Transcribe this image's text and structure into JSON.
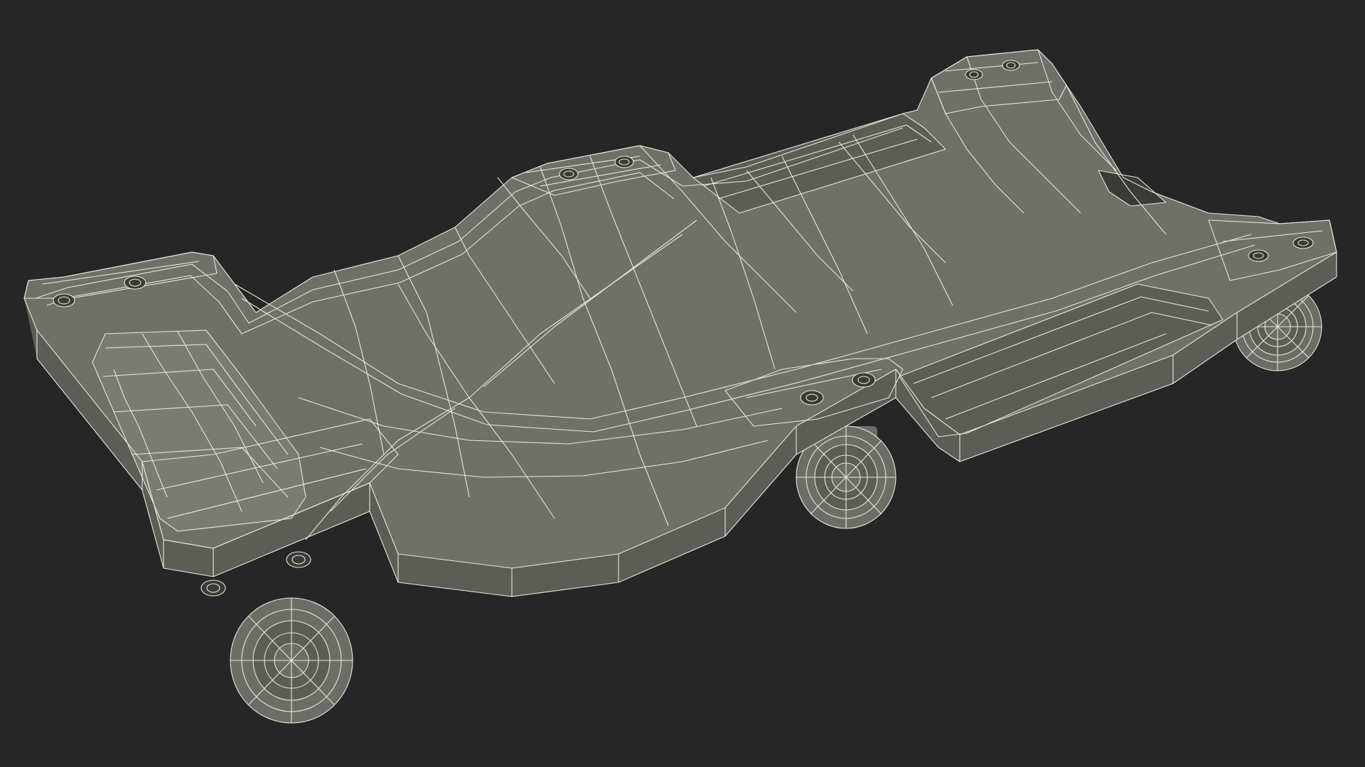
{
  "scene": {
    "subject": "creeper-wireframe-render",
    "background_color": "#262626",
    "surface_color": "#6f7068",
    "surface_shadow_color": "#5c5d56",
    "surface_highlight_color": "#7a7b72",
    "wire_color": "#e8e7d8",
    "hole_color": "#3a3b36",
    "wheel_color": "#6c6d66"
  }
}
